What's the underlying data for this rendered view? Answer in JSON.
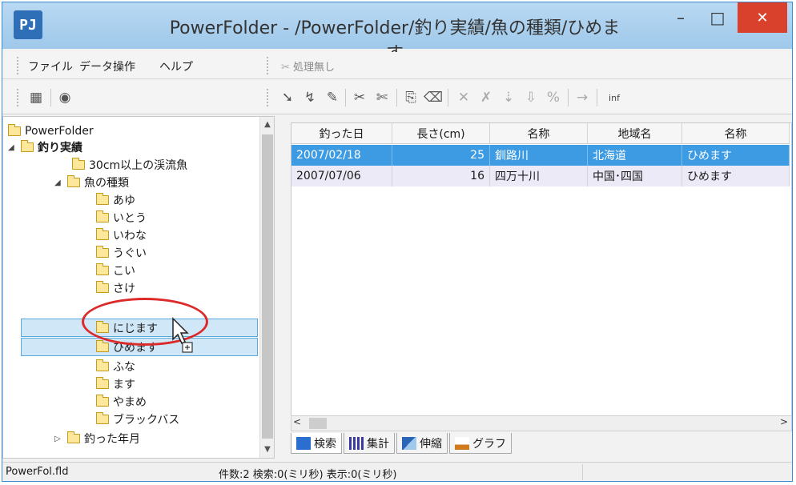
{
  "window": {
    "app_icon": "PJ",
    "title": "PowerFolder - /PowerFolder/釣り実績/魚の種類/ひめます",
    "minimize_glyph": "–",
    "maximize_glyph": "□",
    "close_glyph": "✕"
  },
  "menu": {
    "file": "ファイル",
    "data_ops": "データ操作",
    "help": "ヘルプ",
    "process_status": "処理無し"
  },
  "toolbar": {
    "icons": [
      "table-icon",
      "eye-icon",
      "arrow-icon",
      "dig-icon",
      "edit-icon",
      "cut-icon",
      "scissors-icon",
      "copy-icon",
      "html-icon",
      "x-icon",
      "xx-icon",
      "down-icon",
      "paste-icon",
      "percent-icon",
      "arrow-right-icon",
      "info-icon"
    ],
    "inf_label": "inf"
  },
  "tree": {
    "items": [
      {
        "label": "PowerFolder",
        "level": 0,
        "expander": "",
        "bold": false
      },
      {
        "label": "釣り実績",
        "level": 1,
        "expander": "◢",
        "bold": true
      },
      {
        "label": "30cm以上の渓流魚",
        "level": 2,
        "expander": "",
        "bold": false
      },
      {
        "label": "魚の種類",
        "level": 2,
        "expander": "◢",
        "bold": false
      },
      {
        "label": "あゆ",
        "level": 3,
        "expander": "",
        "bold": false
      },
      {
        "label": "いとう",
        "level": 3,
        "expander": "",
        "bold": false
      },
      {
        "label": "いわな",
        "level": 3,
        "expander": "",
        "bold": false
      },
      {
        "label": "うぐい",
        "level": 3,
        "expander": "",
        "bold": false
      },
      {
        "label": "こい",
        "level": 3,
        "expander": "",
        "bold": false
      },
      {
        "label": "さけ",
        "level": 3,
        "expander": "",
        "bold": false
      },
      {
        "label": "にじます",
        "level": 3,
        "expander": "",
        "bold": false
      },
      {
        "label": "ひめます",
        "level": 3,
        "expander": "",
        "bold": false
      },
      {
        "label": "ふな",
        "level": 3,
        "expander": "",
        "bold": false
      },
      {
        "label": "ます",
        "level": 3,
        "expander": "",
        "bold": false
      },
      {
        "label": "やまめ",
        "level": 3,
        "expander": "",
        "bold": false
      },
      {
        "label": "ブラックバス",
        "level": 3,
        "expander": "",
        "bold": false
      },
      {
        "label": "釣った年月",
        "level": 1,
        "expander": "▷",
        "bold": false
      }
    ]
  },
  "grid": {
    "columns": [
      "釣った日",
      "長さ(cm)",
      "名称",
      "地域名",
      "名称"
    ],
    "rows": [
      {
        "date": "2007/02/18",
        "length": "25",
        "river": "釧路川",
        "region": "北海道",
        "fish": "ひめます",
        "selected": true
      },
      {
        "date": "2007/07/06",
        "length": "16",
        "river": "四万十川",
        "region": "中国･四国",
        "fish": "ひめます",
        "selected": false
      }
    ]
  },
  "tabs": [
    {
      "label": "検索",
      "icon": "search-tab-icon",
      "color": "#2a6fd0"
    },
    {
      "label": "集計",
      "icon": "summary-tab-icon",
      "color": "#3a3aa0"
    },
    {
      "label": "伸縮",
      "icon": "stretch-tab-icon",
      "color": "#2a66b8"
    },
    {
      "label": "グラフ",
      "icon": "graph-tab-icon",
      "color": "#d07a20"
    }
  ],
  "status": {
    "file": "PowerFol.fld",
    "info": "件数:2 検索:0(ミリ秒) 表示:0(ミリ秒)"
  },
  "colors": {
    "accent": "#3c9be3",
    "close": "#d9412c",
    "highlight_circle": "#dc2a2a"
  }
}
